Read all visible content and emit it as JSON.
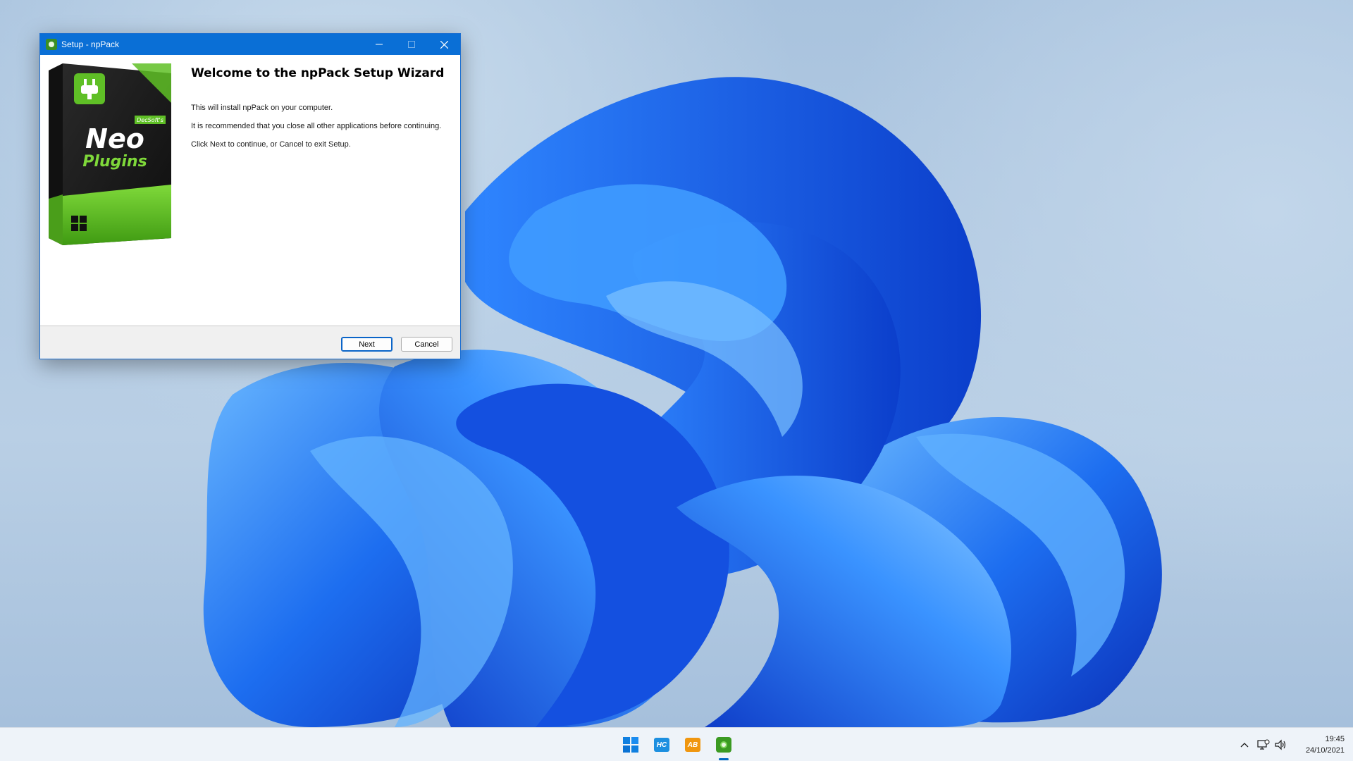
{
  "window": {
    "title": "Setup - npPack",
    "controls": {
      "minimize": "—",
      "maximize": "☐",
      "close": "✕"
    }
  },
  "wizard": {
    "heading": "Welcome to the npPack Setup Wizard",
    "lines": [
      "This will install npPack on your computer.",
      "It is recommended that you close all other applications before continuing.",
      "Click Next to continue, or Cancel to exit Setup."
    ],
    "product_box": {
      "brand": "DecSoft's",
      "name_line1": "Neo",
      "name_line2": "Plugins"
    }
  },
  "footer": {
    "next_label": "Next",
    "cancel_label": "Cancel"
  },
  "taskbar": {
    "apps": [
      {
        "name": "start",
        "icon": "windows-logo-icon"
      },
      {
        "name": "hc",
        "label": "HC"
      },
      {
        "name": "ab",
        "label": "AB"
      },
      {
        "name": "npack-setup",
        "icon": "npack-icon",
        "active": true
      }
    ],
    "tray": {
      "chevron": "^",
      "network": "network-icon",
      "volume": "volume-icon"
    },
    "clock": {
      "time": "19:45",
      "date": "24/10/2021"
    }
  },
  "colors": {
    "titlebar": "#0a6fd6",
    "accent": "#0067c0",
    "brand_green": "#5fbf26",
    "wallpaper_blue": "#1a66e0"
  }
}
